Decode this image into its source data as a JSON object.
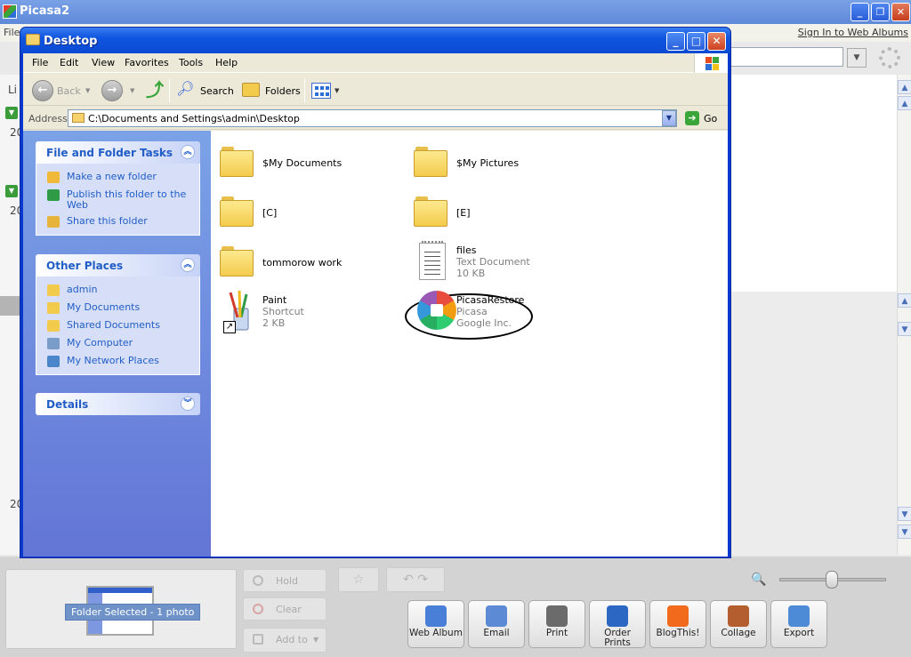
{
  "picasa": {
    "title": "Picasa2",
    "menu_file": "File",
    "sign_in": "Sign In to Web Albums",
    "left_pane": {
      "label": "Li",
      "years": [
        "20",
        "20",
        "20"
      ]
    },
    "tray": {
      "folder_selected": "Folder Selected - 1 photo",
      "hold": "Hold",
      "clear": "Clear",
      "add_to": "Add to",
      "actions": [
        {
          "label": "Web Album",
          "icon": "web-album-icon",
          "color": "#4a7fd8"
        },
        {
          "label": "Email",
          "icon": "email-icon",
          "color": "#5d8ad4"
        },
        {
          "label": "Print",
          "icon": "print-icon",
          "color": "#6b6b6b"
        },
        {
          "label": "Order Prints",
          "icon": "order-prints-icon",
          "color": "#2d67c4"
        },
        {
          "label": "BlogThis!",
          "icon": "blogger-icon",
          "color": "#f26a1b"
        },
        {
          "label": "Collage",
          "icon": "collage-icon",
          "color": "#b45d2e"
        },
        {
          "label": "Export",
          "icon": "export-icon",
          "color": "#4d8bd6"
        }
      ]
    }
  },
  "explorer": {
    "title": "Desktop",
    "menu": [
      "File",
      "Edit",
      "View",
      "Favorites",
      "Tools",
      "Help"
    ],
    "toolbar": {
      "back": "Back",
      "search": "Search",
      "folders": "Folders"
    },
    "address": {
      "label": "Address",
      "path": "C:\\Documents and Settings\\admin\\Desktop",
      "go": "Go"
    },
    "tasks": {
      "file_folder_title": "File and Folder Tasks",
      "file_folder_items": [
        {
          "label": "Make a new folder",
          "color": "#f0b93a"
        },
        {
          "label": "Publish this folder to the Web",
          "color": "#2f9b46"
        },
        {
          "label": "Share this folder",
          "color": "#e7b33a"
        }
      ],
      "other_places_title": "Other Places",
      "other_places_items": [
        {
          "label": "admin",
          "color": "#f3cb4c"
        },
        {
          "label": "My Documents",
          "color": "#f3cb4c"
        },
        {
          "label": "Shared Documents",
          "color": "#f3cb4c"
        },
        {
          "label": "My Computer",
          "color": "#7a9cc9"
        },
        {
          "label": "My Network Places",
          "color": "#4a86c9"
        }
      ],
      "details_title": "Details"
    },
    "files": [
      {
        "name": "$My Documents",
        "type": "folder"
      },
      {
        "name": "$My Pictures",
        "type": "folder"
      },
      {
        "name": "[C]",
        "type": "folder"
      },
      {
        "name": "[E]",
        "type": "folder"
      },
      {
        "name": "tommorow work",
        "type": "folder"
      },
      {
        "name": "files",
        "line2": "Text Document",
        "line3": "10 KB",
        "type": "text"
      },
      {
        "name": "Paint",
        "line2": "Shortcut",
        "line3": "2 KB",
        "type": "shortcut"
      },
      {
        "name": "PicasaRestore",
        "line2": "Picasa",
        "line3": "Google Inc.",
        "type": "app"
      }
    ]
  }
}
